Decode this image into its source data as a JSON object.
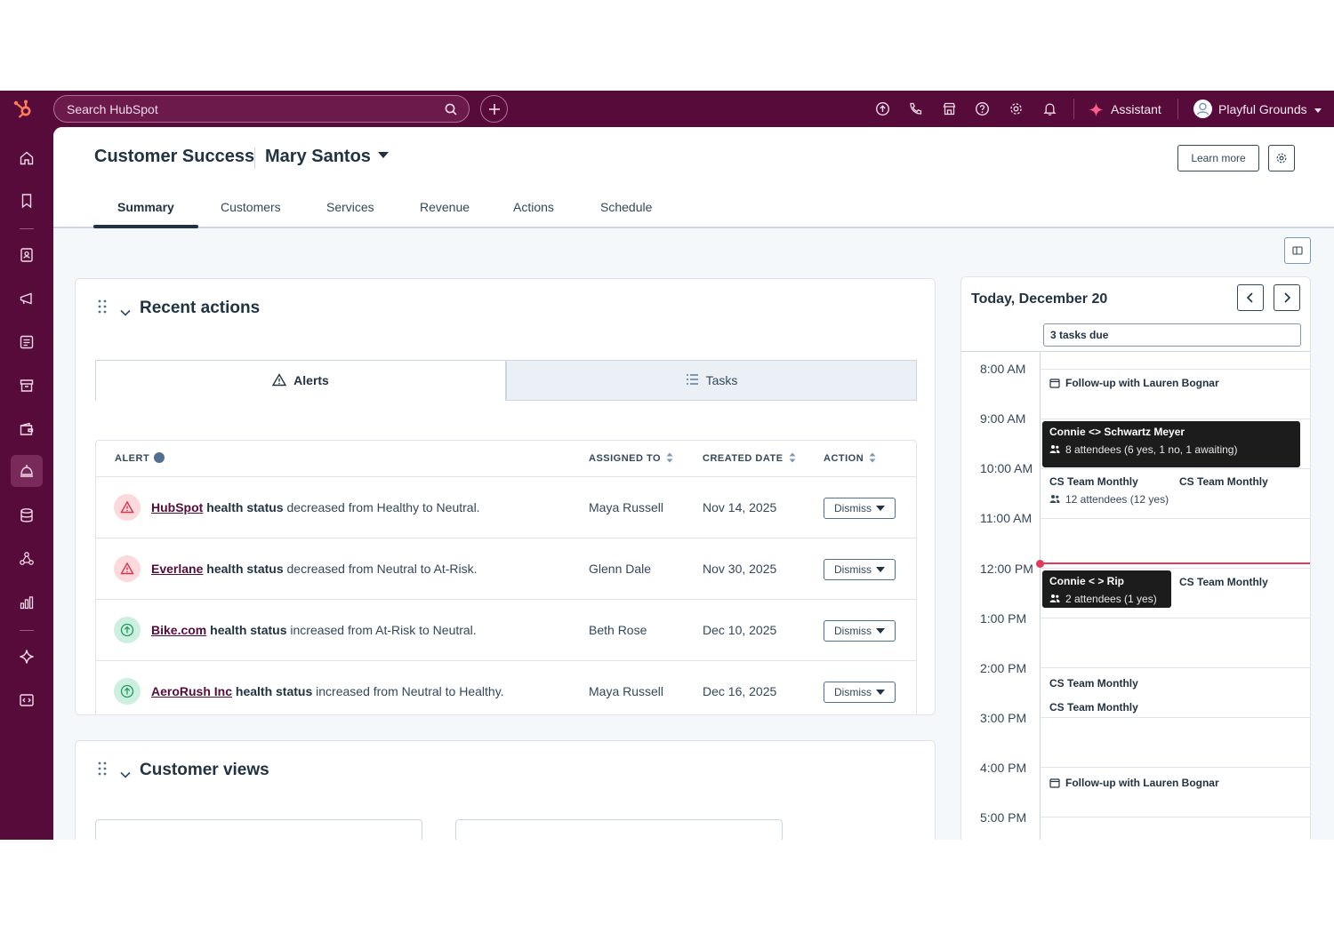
{
  "topbar": {
    "search_placeholder": "Search HubSpot",
    "assistant_label": "Assistant",
    "account_name": "Playful Grounds"
  },
  "header": {
    "hub_title": "Customer Success",
    "owner": "Mary Santos",
    "learn_more": "Learn more",
    "tabs": [
      "Summary",
      "Customers",
      "Services",
      "Revenue",
      "Actions",
      "Schedule"
    ],
    "active_tab": "Summary"
  },
  "recent_actions": {
    "title": "Recent actions",
    "subtabs": {
      "alerts": "Alerts",
      "tasks": "Tasks"
    },
    "columns": [
      "ALERT",
      "ASSIGNED TO",
      "CREATED DATE",
      "ACTION"
    ],
    "rows": [
      {
        "company": "HubSpot",
        "metric": "health status",
        "change": "decreased from Healthy to Neutral.",
        "direction": "down",
        "assigned": "Maya Russell",
        "date": "Nov 14, 2025",
        "action": "Dismiss"
      },
      {
        "company": "Everlane",
        "metric": "health status",
        "change": "decreased from Neutral to At-Risk.",
        "direction": "down",
        "assigned": "Glenn Dale",
        "date": "Nov 30, 2025",
        "action": "Dismiss"
      },
      {
        "company": "Bike.com",
        "metric": "health status",
        "change": "increased from At-Risk to Neutral.",
        "direction": "up",
        "assigned": "Beth Rose",
        "date": "Dec 10, 2025",
        "action": "Dismiss"
      },
      {
        "company": "AeroRush Inc",
        "metric": "health status",
        "change": "increased from Neutral to Healthy.",
        "direction": "up",
        "assigned": "Maya Russell",
        "date": "Dec 16, 2025",
        "action": "Dismiss"
      }
    ]
  },
  "customer_views": {
    "title": "Customer views"
  },
  "schedule": {
    "title": "Today, December 20",
    "tasks_due": "3 tasks due",
    "hours": [
      "8:00 AM",
      "9:00 AM",
      "10:00 AM",
      "11:00 AM",
      "12:00 PM",
      "1:00 PM",
      "2:00 PM",
      "3:00 PM",
      "4:00 PM",
      "5:00 PM"
    ],
    "events": {
      "followup_1": "Follow-up with Lauren Bognar",
      "connie_schwartz": {
        "name": "Connie <> Schwartz Meyer",
        "attendees": "8 attendees (6 yes, 1 no, 1 awaiting)"
      },
      "cs_monthly_a": {
        "name": "CS Team Monthly",
        "attendees": "12 attendees (12 yes)"
      },
      "cs_monthly_b": "CS Team Monthly",
      "connie_rip": {
        "name": "Connie < > Rip",
        "attendees": "2 attendees (1 yes)"
      },
      "cs_monthly_c": "CS Team Monthly",
      "cs_monthly_d": "CS Team Monthly",
      "cs_monthly_e": "CS Team Monthly",
      "followup_2": "Follow-up with Lauren Bognar"
    }
  },
  "colors": {
    "nav_bg": "#560b3a",
    "alert_down_bg": "#fbd9dc",
    "alert_down_fg": "#d9334a",
    "alert_up_bg": "#cdefe0",
    "alert_up_fg": "#1f9b62",
    "now_line": "#e53b5a"
  }
}
